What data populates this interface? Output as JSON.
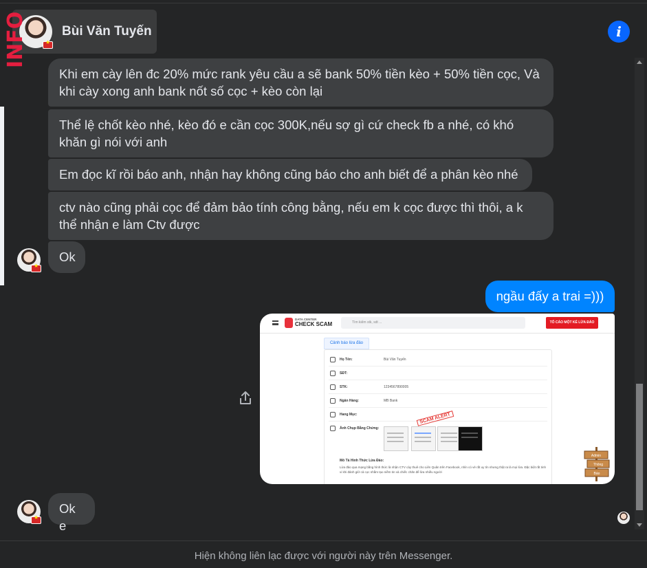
{
  "watermark": "INFO",
  "header": {
    "name": "Bùi Văn Tuyến"
  },
  "messages": {
    "m1": "Khi em cày lên đc 20% mức rank yêu cầu a sẽ bank 50% tiền kèo + 50% tiền cọc, Và khi cày xong anh bank nốt số cọc + kèo còn lại",
    "m2": "Thể lệ chốt kèo nhé, kèo đó e cần cọc 300K,nếu sợ gì cứ check fb a nhé, có khó khăn gì nói với anh",
    "m3": "Em đọc kĩ rồi báo anh, nhận hay không cũng báo cho anh biết để a phân kèo nhé",
    "m4": "ctv nào cũng phải cọc để đảm bảo tính công bằng, nếu em k cọc được thì thôi, a k thể nhận e làm Ctv được",
    "m5": "Ok",
    "sent": "ngầu đấy a trai =)))",
    "m6": "Ok e"
  },
  "attachment": {
    "brand_top": "DATA CENTER",
    "brand": "CHECK SCAM",
    "search_placeholder": "Tìm kiếm stk, sdt ...",
    "report_button": "TỐ CÁO MỘT KẺ LỪA ĐẢO",
    "tab": "Cảnh báo lừa đảo",
    "rows": [
      {
        "label": "Họ Tên:",
        "value": "Bùi Văn Tuyến"
      },
      {
        "label": "SĐT:",
        "value": ""
      },
      {
        "label": "STK:",
        "value": "1234567890005"
      },
      {
        "label": "Ngân Hàng:",
        "value": "MB Bank"
      },
      {
        "label": "Hang Mục:",
        "value": ""
      },
      {
        "label": "Ảnh Chụp Bằng Chứng:",
        "value": ""
      }
    ],
    "stamp": "SCAM ALERT",
    "desc_title": "Mô Tả Hình Thức Lừa Đảo:",
    "desc": "Lừa đảo qua mạng bằng hình thức là nhận CTV cày thuê cho Liên Quân trên Facebook, nhìn có vẻ rất uy tín nhưng thật ra là mọi lừa. Đặc biệt rất tinh vi khi đánh giữ cả cọc nhằm tạo niềm tin và chiếc chăn để lừa nhiều người",
    "sign_text": "Admin Thông Báo"
  },
  "footer": "Hiện không liên lạc được với người này trên Messenger.",
  "colors": {
    "sent_bubble": "#0084ff",
    "received_bubble": "#3e4042",
    "background": "#242526",
    "info_button": "#0866ff"
  }
}
